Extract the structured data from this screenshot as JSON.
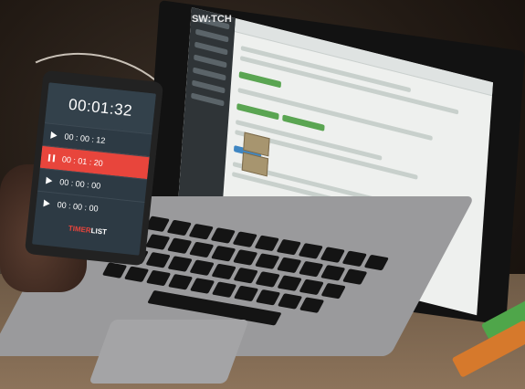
{
  "laptop": {
    "logo_text": "SW:TCH"
  },
  "phone": {
    "main_time": "00:01:32",
    "timers": [
      {
        "time": "00 : 00 : 12"
      },
      {
        "time": "00 : 01 : 20"
      },
      {
        "time": "00 : 00 : 00"
      },
      {
        "time": "00 : 00 : 00"
      }
    ],
    "app_name_left": "TIMER",
    "app_name_right": "LIST"
  },
  "colors": {
    "phone_active_row": "#e8453c",
    "laptop_sidebar": "#2f3437",
    "marker_green": "#4fa64a",
    "marker_orange": "#d6792c"
  }
}
